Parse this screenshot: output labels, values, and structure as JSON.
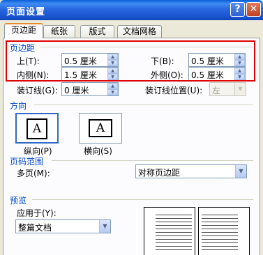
{
  "title": "页面设置",
  "titlebar": {
    "help": "?",
    "close": "✕"
  },
  "tabs": [
    "页边距",
    "纸张",
    "版式",
    "文档网格"
  ],
  "margins": {
    "label": "页边距",
    "top_label": "上(T):",
    "top_value": "0.5 厘米",
    "bottom_label": "下(B):",
    "bottom_value": "0.5 厘米",
    "inside_label": "内侧(N):",
    "inside_value": "1.5 厘米",
    "outside_label": "外侧(O):",
    "outside_value": "0.5 厘米",
    "gutter_label": "装订线(G):",
    "gutter_value": "0 厘米",
    "gutter_pos_label": "装订线位置(U):",
    "gutter_pos_value": "左"
  },
  "orientation": {
    "label": "方向",
    "portrait": "纵向(P)",
    "landscape": "横向(S)",
    "glyph": "A"
  },
  "pages": {
    "label": "页码范围",
    "multiple_label": "多页(M):",
    "multiple_value": "对称页边距"
  },
  "preview": {
    "label": "预览",
    "apply_label": "应用于(Y):",
    "apply_value": "整篇文档"
  },
  "colors": {
    "accent": "#0046d5",
    "highlight": "#e00000",
    "titlebar": "#2767df"
  }
}
